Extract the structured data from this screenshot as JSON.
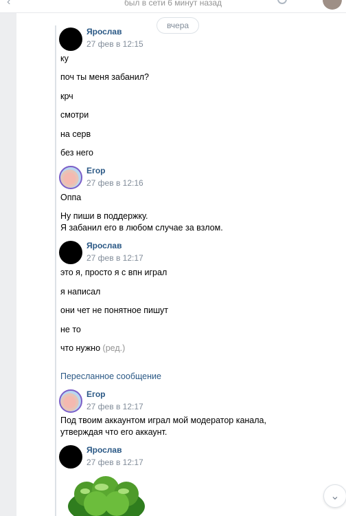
{
  "header": {
    "status": "был в сети 6 минут назад"
  },
  "date_separator": "вчера",
  "forwarded_label": "Пересланное сообщение",
  "groups": [
    {
      "author": "Ярослав",
      "time": "27 фев в 12:15",
      "messages": [
        "ку",
        "поч ты меня забанил?",
        "крч",
        "смотри",
        "на серв",
        "без него"
      ]
    },
    {
      "author": "Егор",
      "time": "27 фев в 12:16",
      "messages": [
        "Оппа",
        "Ну пиши в поддержку.\nЯ забанил его в любом случае за взлом."
      ]
    },
    {
      "author": "Ярослав",
      "time": "27 фев в 12:17",
      "messages": [
        "это я, просто я с впн играл",
        "я написал",
        "они чет не понятное пишут",
        "не то",
        "что нужно"
      ],
      "edited_mark": "(ред.)"
    },
    {
      "author": "Егор",
      "time": "27 фев в 12:17",
      "messages": [
        "Под твоим аккаунтом играл мой модератор канала,\nутверждая что его аккаунт."
      ]
    },
    {
      "author": "Ярослав",
      "time": "27 фев в 12:17"
    }
  ],
  "icons": {
    "back": "chevron-left-icon",
    "search": "search-icon",
    "scroll_down": "chevron-down-icon"
  }
}
